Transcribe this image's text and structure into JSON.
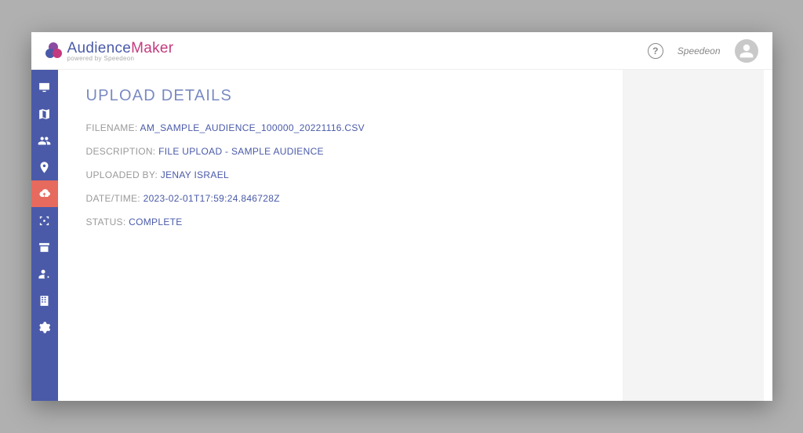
{
  "brand": {
    "part1": "Audience",
    "part2": "Maker",
    "subtitle": "powered by Speedeon"
  },
  "header": {
    "username": "Speedeon"
  },
  "page": {
    "title": "UPLOAD DETAILS"
  },
  "details": {
    "filename_label": "FILENAME:",
    "filename_value": "AM_SAMPLE_AUDIENCE_100000_20221116.CSV",
    "description_label": "DESCRIPTION:",
    "description_value": "FILE UPLOAD - SAMPLE AUDIENCE",
    "uploaded_by_label": "UPLOADED BY:",
    "uploaded_by_value": "JENAY ISRAEL",
    "datetime_label": "DATE/TIME:",
    "datetime_value": "2023-02-01T17:59:24.846728Z",
    "status_label": "STATUS:",
    "status_value": "COMPLETE"
  },
  "sidebar": {
    "items": [
      {
        "name": "monitor",
        "active": false
      },
      {
        "name": "map",
        "active": false
      },
      {
        "name": "users",
        "active": false
      },
      {
        "name": "pin",
        "active": false
      },
      {
        "name": "cloud-upload",
        "active": true
      },
      {
        "name": "target",
        "active": false
      },
      {
        "name": "archive",
        "active": false
      },
      {
        "name": "user-settings",
        "active": false
      },
      {
        "name": "building",
        "active": false
      },
      {
        "name": "settings",
        "active": false
      }
    ]
  }
}
